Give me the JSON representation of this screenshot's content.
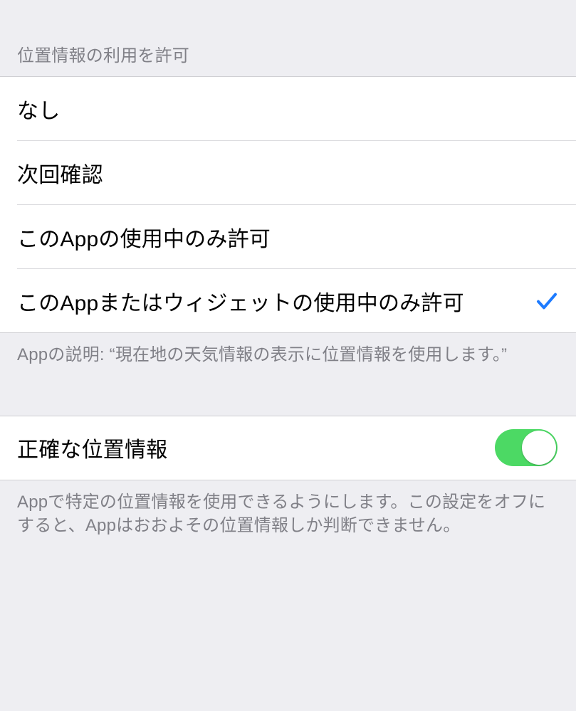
{
  "location_access": {
    "header": "位置情報の利用を許可",
    "options": [
      {
        "label": "なし",
        "selected": false
      },
      {
        "label": "次回確認",
        "selected": false
      },
      {
        "label": "このAppの使用中のみ許可",
        "selected": false
      },
      {
        "label": "このAppまたはウィジェットの使用中のみ許可",
        "selected": true
      }
    ],
    "footer": "Appの説明: “現在地の天気情報の表示に位置情報を使用します。”"
  },
  "precise_location": {
    "label": "正確な位置情報",
    "value": true,
    "footer": "Appで特定の位置情報を使用できるようにします。この設定をオフにすると、Appはおおよその位置情報しか判断できません。"
  }
}
